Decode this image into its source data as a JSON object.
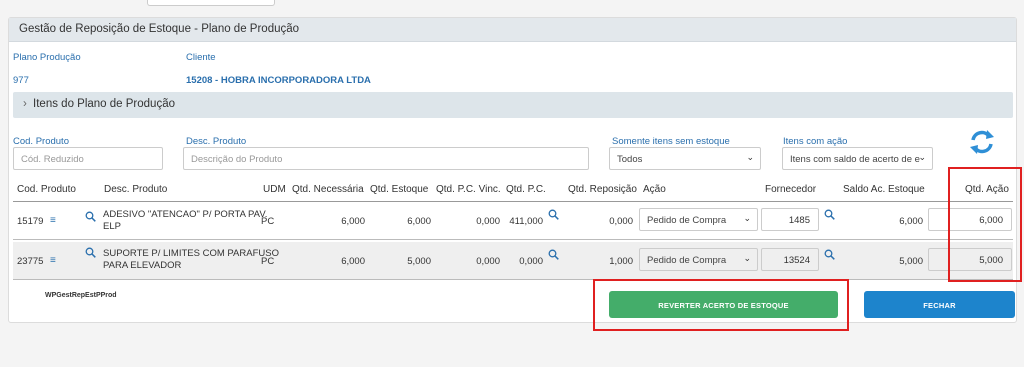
{
  "panel_title": "Gestão de Reposição de Estoque - Plano de Produção",
  "plano": {
    "label": "Plano Produção",
    "value": "977"
  },
  "cliente": {
    "label": "Cliente",
    "value": "15208 - HOBRA INCORPORADORA LTDA"
  },
  "section_title": "Itens do Plano de Produção",
  "filters": {
    "cod_produto": {
      "label": "Cod. Produto",
      "placeholder": "Cód. Reduzido"
    },
    "desc_produto": {
      "label": "Desc. Produto",
      "placeholder": "Descrição do Produto"
    },
    "sem_estoque": {
      "label": "Somente itens sem estoque",
      "selected": "Todos"
    },
    "com_acao": {
      "label": "Itens com ação",
      "selected": "Itens com saldo de acerto de e"
    }
  },
  "table": {
    "headers": [
      "Cod. Produto",
      "Desc. Produto",
      "UDM",
      "Qtd. Necessária",
      "Qtd. Estoque",
      "Qtd. P.C. Vinc.",
      "Qtd. P.C.",
      "Qtd. Reposição",
      "Ação",
      "Fornecedor",
      "Saldo Ac. Estoque",
      "Qtd. Ação"
    ],
    "rows": [
      {
        "cod": "15179",
        "desc_line1": "ADESIVO \"ATENCAO\" P/ PORTA PAV.",
        "desc_line2": "ELP",
        "udm": "PC",
        "qtd_necessaria": "6,000",
        "qtd_estoque": "6,000",
        "qtd_pc_vinc": "0,000",
        "qtd_pc": "411,000",
        "qtd_reposicao": "0,000",
        "acao": "Pedido de Compra",
        "fornecedor": "1485",
        "saldo": "6,000",
        "qtd_acao": "6,000"
      },
      {
        "cod": "23775",
        "desc_line1": "SUPORTE P/ LIMITES COM PARAFUSO",
        "desc_line2": "PARA ELEVADOR",
        "udm": "PC",
        "qtd_necessaria": "6,000",
        "qtd_estoque": "5,000",
        "qtd_pc_vinc": "0,000",
        "qtd_pc": "0,000",
        "qtd_reposicao": "1,000",
        "acao": "Pedido de Compra",
        "fornecedor": "13524",
        "saldo": "5,000",
        "qtd_acao": "5,000"
      }
    ]
  },
  "footer_label": "WPGestRepEstPProd",
  "buttons": {
    "reverter": "REVERTER ACERTO DE ESTOQUE",
    "fechar": "FECHAR"
  },
  "colors": {
    "link_blue": "#2a6fad",
    "green": "#44ad6a",
    "blue": "#1d84cc",
    "highlight_red": "#e02020"
  },
  "icons": [
    "chevron-right-icon",
    "refresh-icon",
    "list-icon",
    "search-icon",
    "chevron-down-icon"
  ]
}
